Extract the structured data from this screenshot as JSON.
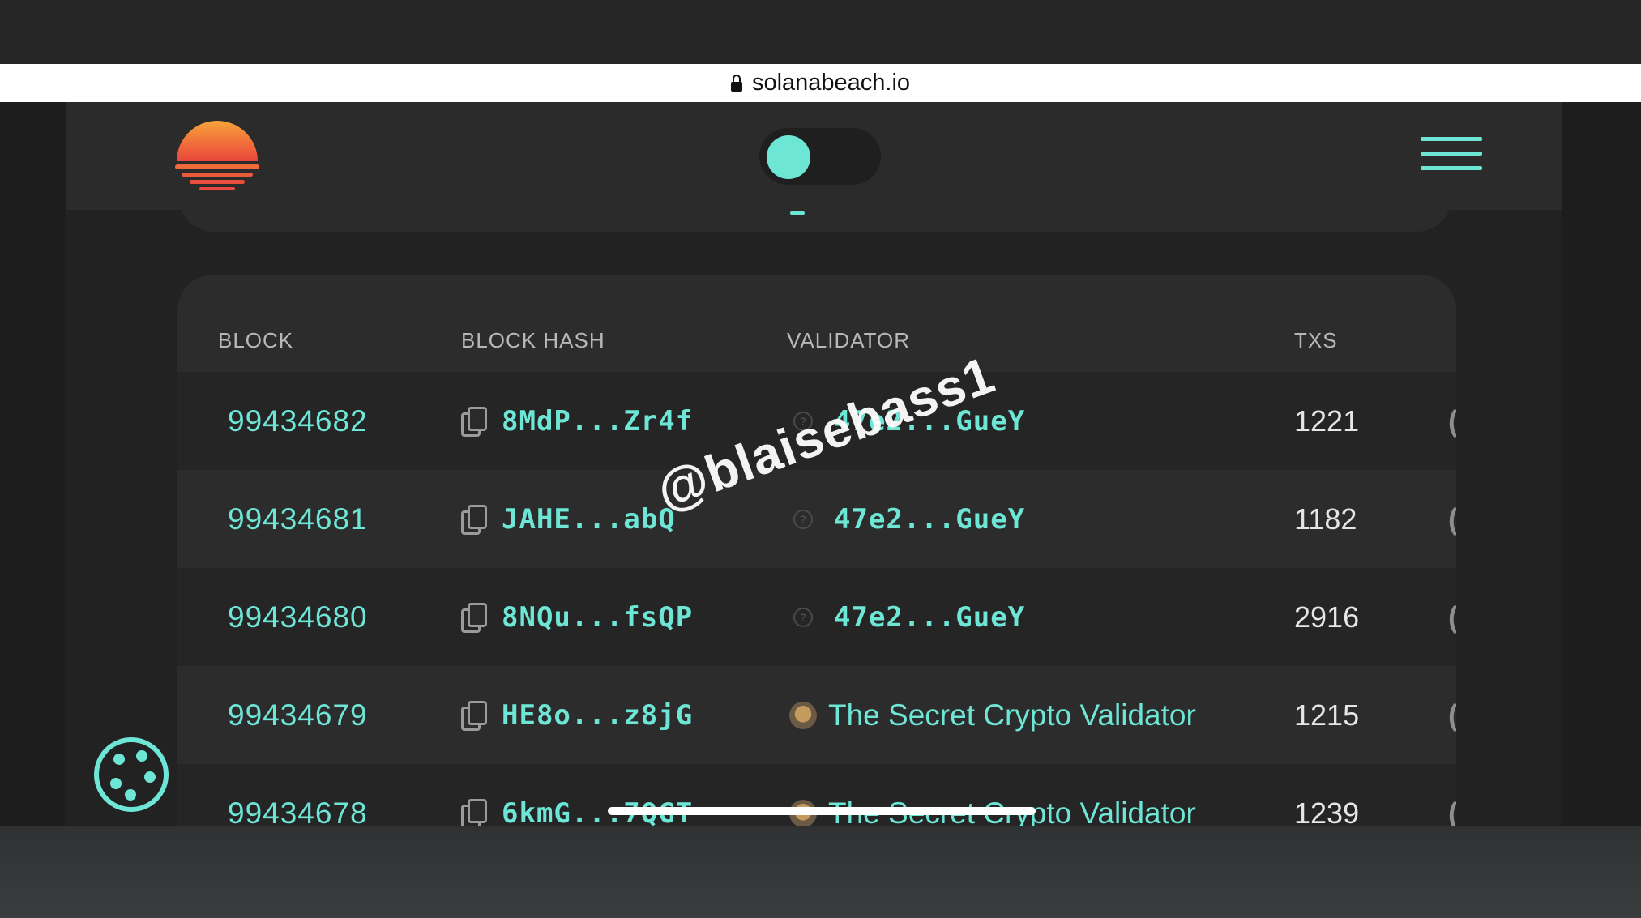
{
  "browser": {
    "url": "solanabeach.io"
  },
  "header": {
    "logo_icon": "sunset-logo-icon",
    "theme_toggle_icon": "theme-toggle",
    "menu_icon": "hamburger-menu-icon"
  },
  "table": {
    "columns": [
      "BLOCK",
      "BLOCK HASH",
      "VALIDATOR",
      "TXS"
    ],
    "rows": [
      {
        "block": "99434682",
        "hash": "8MdP...Zr4f",
        "validator": "47e2...GueY",
        "validator_type": "hash",
        "txs": "1221",
        "clipped": "("
      },
      {
        "block": "99434681",
        "hash": "JAHE...abQ",
        "validator": "47e2...GueY",
        "validator_type": "hash",
        "txs": "1182",
        "clipped": "("
      },
      {
        "block": "99434680",
        "hash": "8NQu...fsQP",
        "validator": "47e2...GueY",
        "validator_type": "hash",
        "txs": "2916",
        "clipped": "("
      },
      {
        "block": "99434679",
        "hash": "HE8o...z8jG",
        "validator": "The Secret Crypto Validator",
        "validator_type": "name",
        "txs": "1215",
        "clipped": "("
      },
      {
        "block": "99434678",
        "hash": "6kmG...7QGT",
        "validator": "The Secret Crypto Validator",
        "validator_type": "name",
        "txs": "1239",
        "clipped": "("
      }
    ]
  },
  "overlay": {
    "watermark": "@blaisebass1"
  },
  "cookie_icon": "cookie-icon",
  "colors": {
    "accent": "#6ee6d6",
    "background": "#222223",
    "card": "#2c2c2d"
  }
}
